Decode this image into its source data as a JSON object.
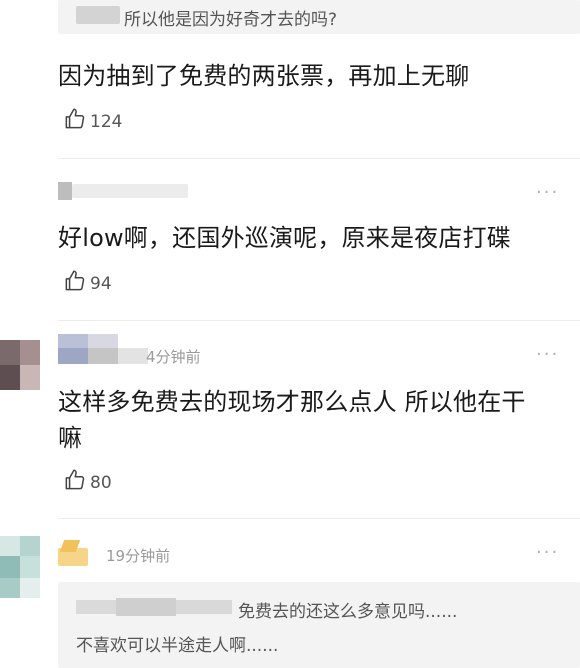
{
  "comments": [
    {
      "quote_text": "所以他是因为好奇才去的吗?",
      "body": "因为抽到了免费的两张票，再加上无聊",
      "likes": "124"
    },
    {
      "body": "好low啊，还国外巡演呢，原来是夜店打碟",
      "likes": "94",
      "more": "···"
    },
    {
      "time": "4分钟前",
      "body_line1": "这样多免费去的现场才那么点人 所以他在干",
      "body_line2": "嘛",
      "likes": "80",
      "more": "···"
    },
    {
      "time": "19分钟前",
      "more": "···",
      "quote_line1": "免费去的还这么多意见吗......",
      "quote_line2": "不喜欢可以半途走人啊......"
    }
  ]
}
